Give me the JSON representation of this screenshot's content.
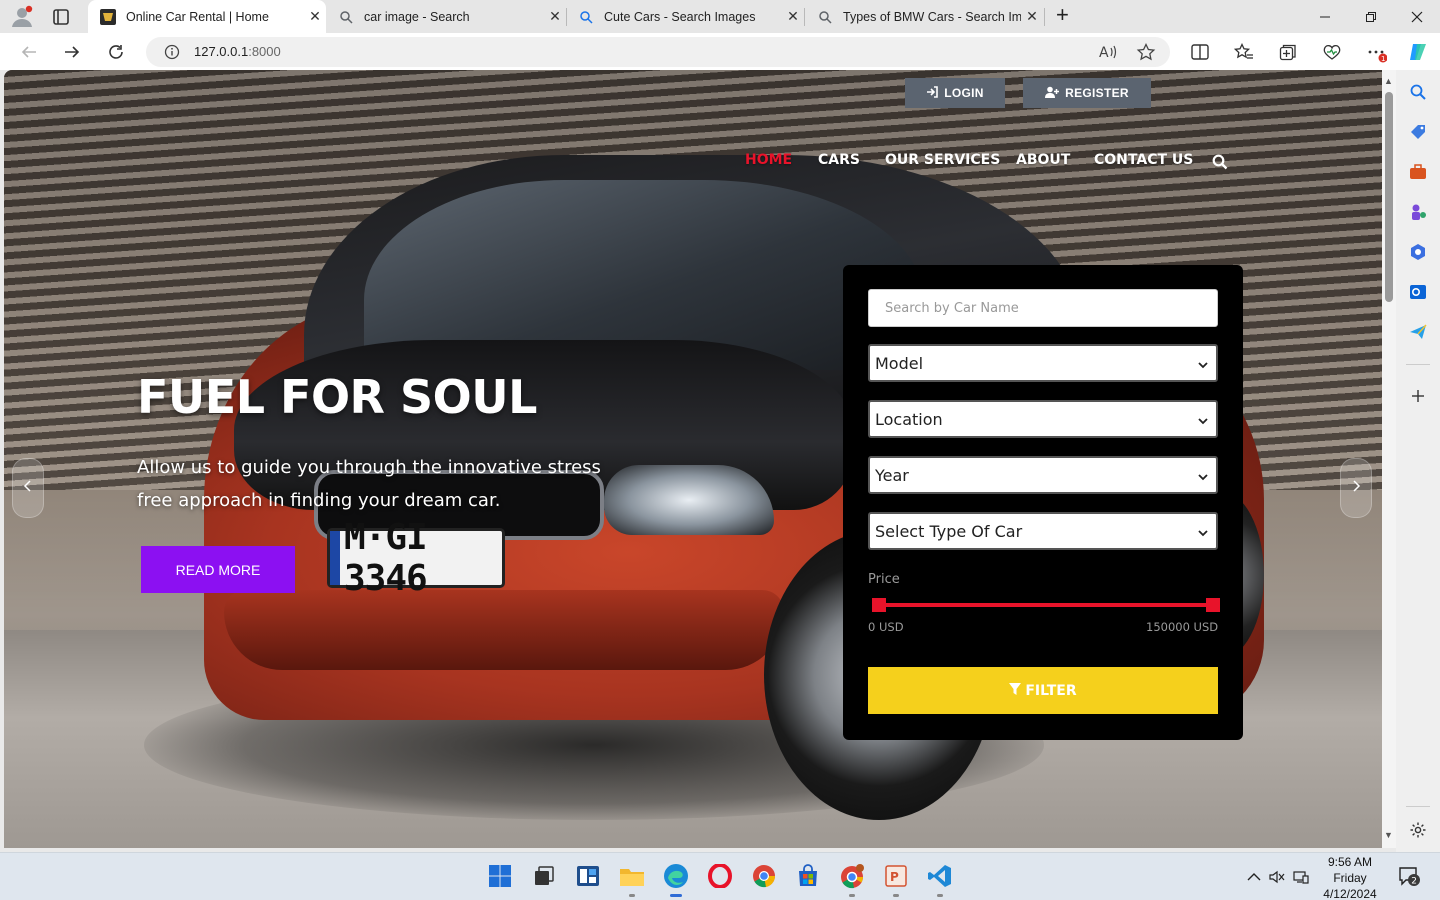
{
  "browser": {
    "tabs": [
      {
        "title": "Online Car Rental | Home",
        "active": true
      },
      {
        "title": "car image - Search",
        "active": false
      },
      {
        "title": "Cute Cars - Search Images",
        "active": false
      },
      {
        "title": "Types of BMW Cars - Search Images",
        "active": false
      }
    ],
    "url_host": "127.0.0.1",
    "url_port": ":8000",
    "notification_badge": "1"
  },
  "page": {
    "auth": {
      "login_label": "LOGIN",
      "register_label": "REGISTER"
    },
    "nav": [
      {
        "label": "HOME",
        "active": true
      },
      {
        "label": "CARS",
        "active": false
      },
      {
        "label": "OUR SERVICES",
        "active": false
      },
      {
        "label": "ABOUT",
        "active": false
      },
      {
        "label": "CONTACT US",
        "active": false
      }
    ],
    "hero": {
      "title": "FUEL FOR SOUL",
      "subtitle": "Allow us to guide you through the innovative stress free approach in finding your dream car.",
      "cta_label": "READ MORE",
      "plate_text": "M·GI 3346"
    },
    "filter": {
      "search_placeholder": "Search by Car Name",
      "selects": [
        "Model",
        "Location",
        "Year",
        "Select Type Of Car"
      ],
      "price_label": "Price",
      "price_min": "0 USD",
      "price_max": "150000 USD",
      "price_range_fraction": [
        0.0,
        1.0
      ],
      "filter_label": "FILTER"
    },
    "colors": {
      "accent_red": "#e8132a",
      "cta_purple": "#8c10f2",
      "filter_yellow": "#f5d01c",
      "auth_gray": "#5b6470"
    }
  },
  "taskbar": {
    "time": "9:56 AM",
    "day": "Friday",
    "date": "4/12/2024",
    "notification_count": "2"
  }
}
